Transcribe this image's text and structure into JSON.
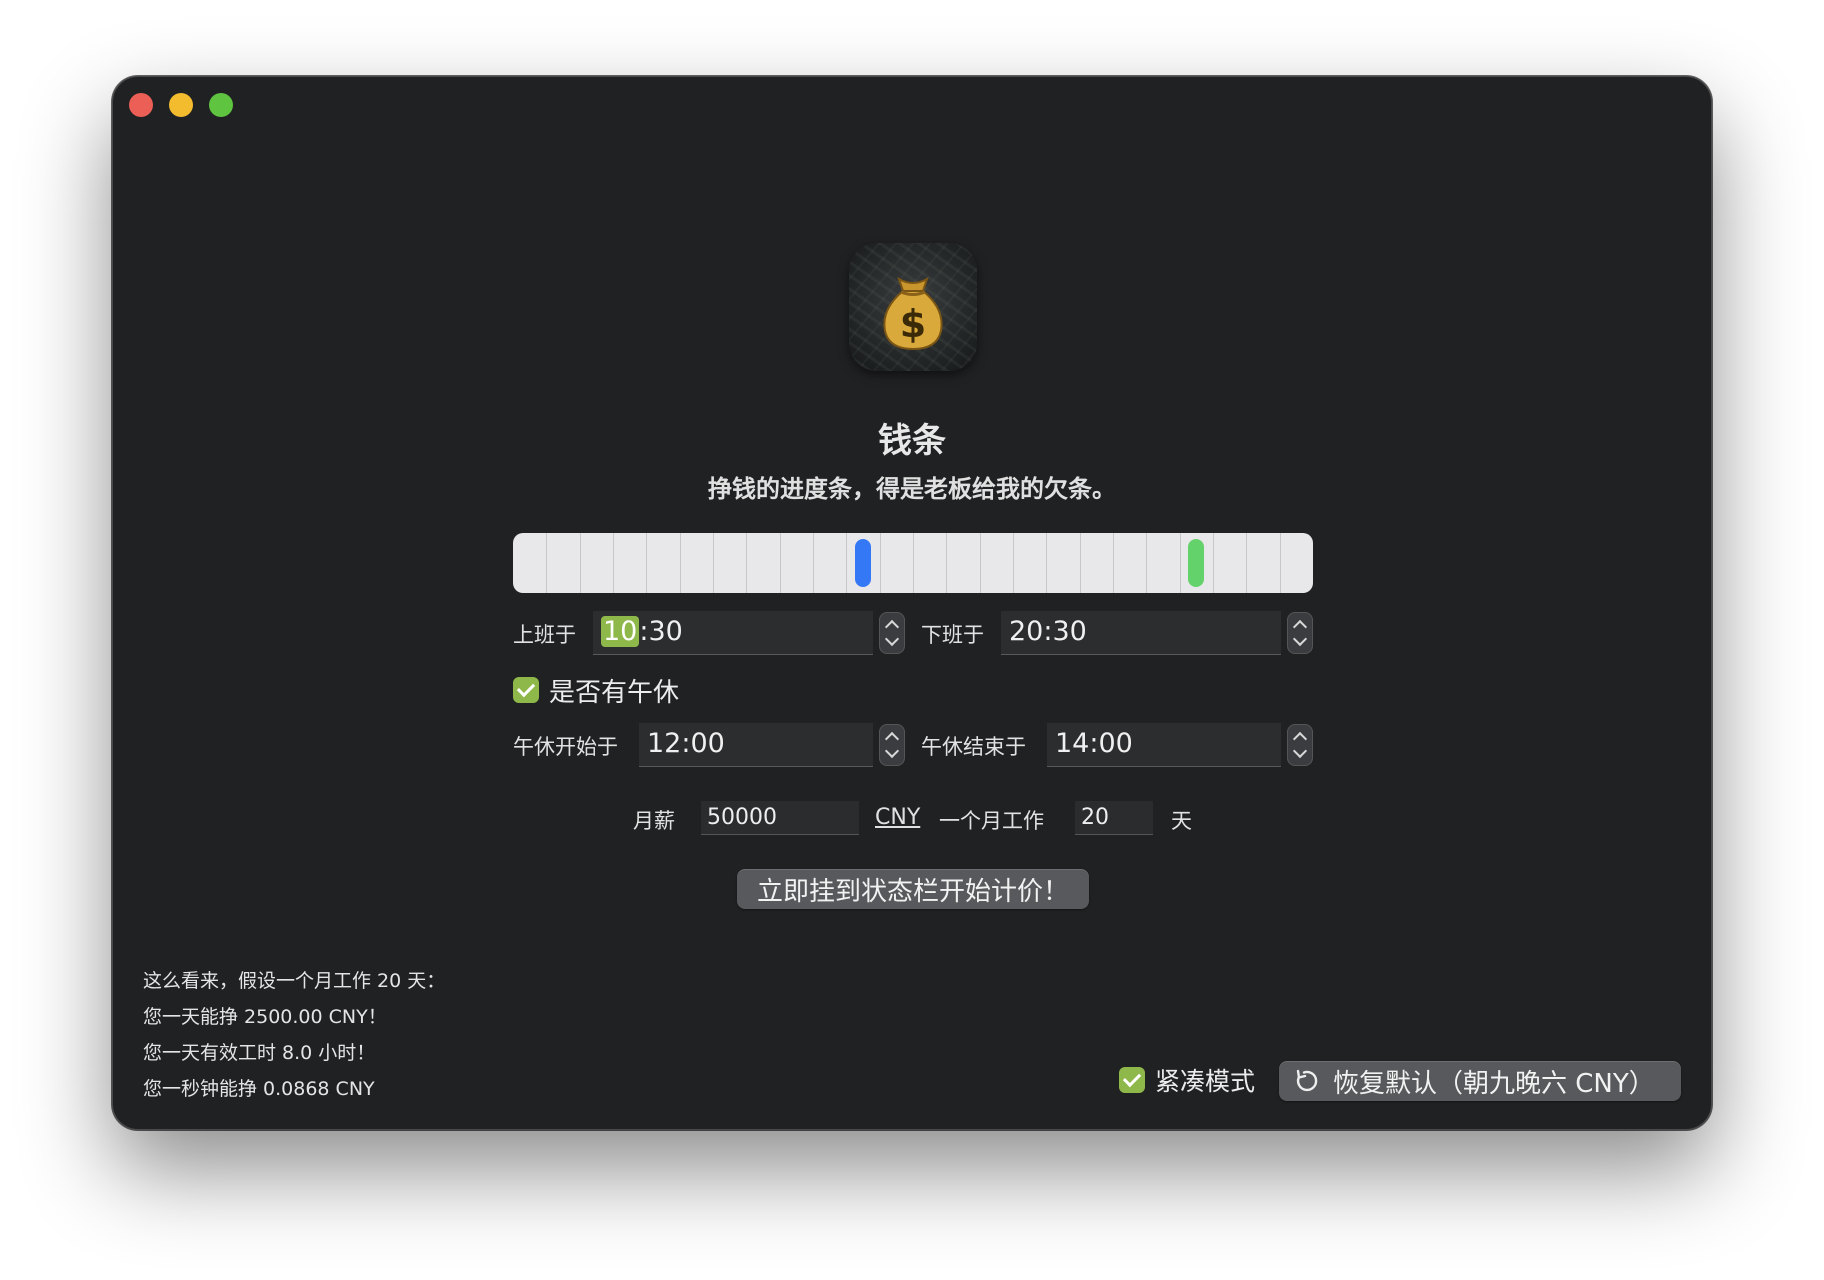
{
  "app": {
    "name": "钱条",
    "tagline": "挣钱的进度条，得是老板给我的欠条。",
    "icon": "money-bag-icon"
  },
  "progress": {
    "tick_count": 24,
    "start_fraction": 0.4375,
    "end_fraction": 0.854,
    "start_color": "#3478f6",
    "end_color": "#63d26a"
  },
  "work": {
    "start_label": "上班于",
    "start_hour": "10",
    "start_rest": ":30",
    "end_label": "下班于",
    "end_value": "20:30"
  },
  "lunch": {
    "checkbox_label": "是否有午休",
    "checked": true,
    "start_label": "午休开始于",
    "start_value": "12:00",
    "end_label": "午休结束于",
    "end_value": "14:00"
  },
  "salary": {
    "label": "月薪",
    "value": "50000",
    "currency": "CNY",
    "days_label": "一个月工作",
    "days_value": "20",
    "days_unit": "天"
  },
  "start_button": "立即挂到状态栏开始计价！",
  "summary": [
    "这么看来，假设一个月工作 20 天：",
    "您一天能挣 2500.00 CNY！",
    "您一天有效工时 8.0 小时！",
    "您一秒钟能挣 0.0868 CNY"
  ],
  "compact": {
    "label": "紧凑模式",
    "checked": true
  },
  "reset_button": "恢复默认（朝九晚六 CNY）",
  "accent_color": "#8fb84a"
}
